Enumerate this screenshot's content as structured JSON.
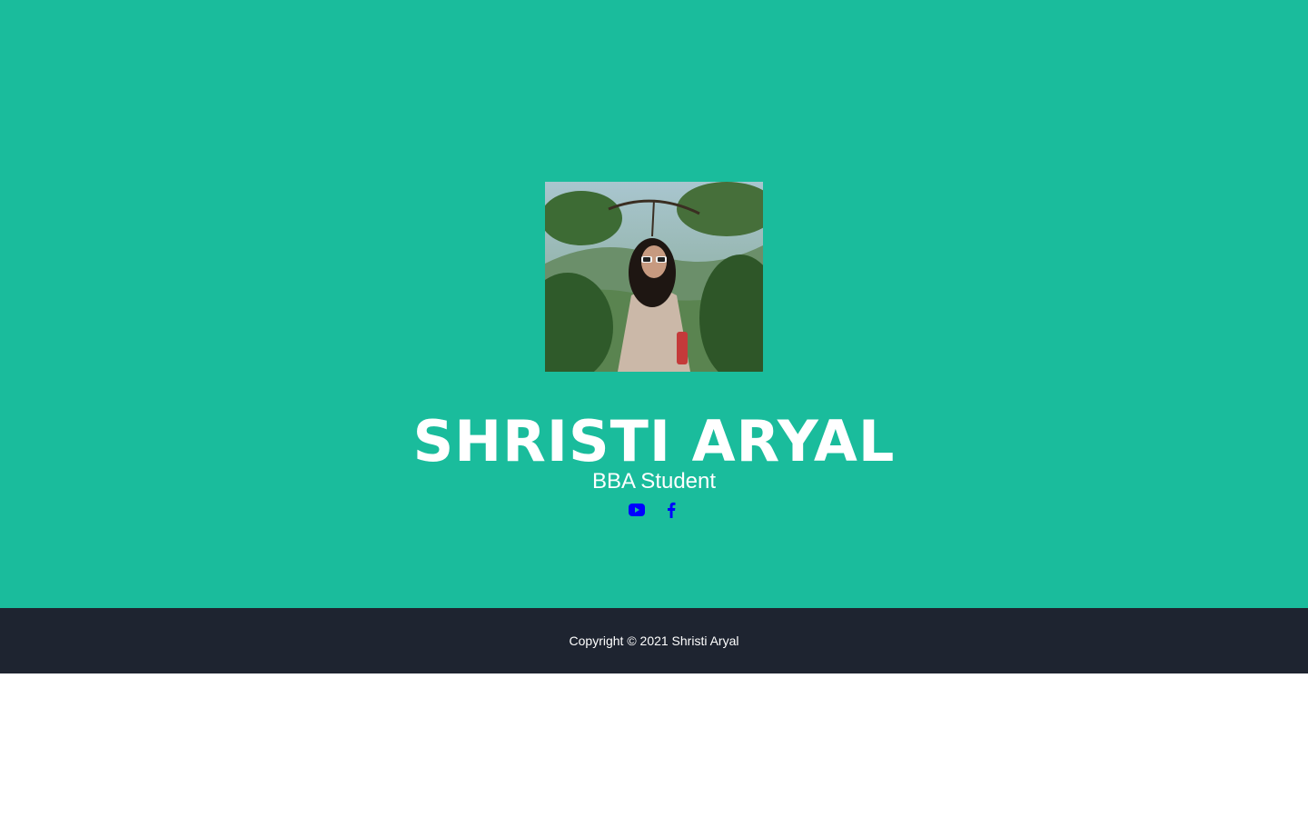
{
  "profile": {
    "name": "SHRISTI ARYAL",
    "role": "BBA Student",
    "photo_icon": "portrait-photo"
  },
  "socials": [
    {
      "name": "youtube",
      "icon": "youtube-icon"
    },
    {
      "name": "facebook",
      "icon": "facebook-icon"
    }
  ],
  "footer": {
    "copyright": "Copyright © 2021 Shristi Aryal"
  },
  "colors": {
    "hero_bg": "#1abc9c",
    "footer_bg": "#1e2430",
    "text": "#ffffff",
    "link": "#0000ff"
  }
}
